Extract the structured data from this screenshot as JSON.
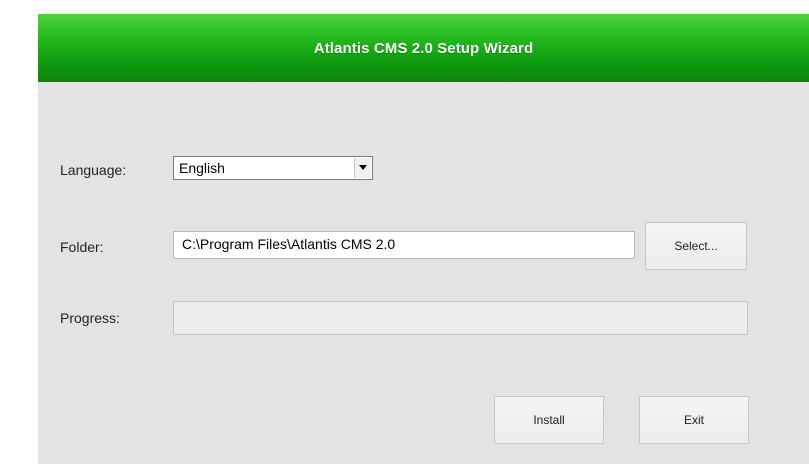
{
  "window": {
    "title": "Atlantis CMS 2.0 Setup Wizard"
  },
  "colors": {
    "titlebar_top": "#4fd33f",
    "titlebar_bottom": "#0b850b",
    "window_bg": "#e3e3e3"
  },
  "form": {
    "language_label": "Language:",
    "language_value": "English",
    "folder_label": "Folder:",
    "folder_value": "C:\\Program Files\\Atlantis CMS 2.0",
    "select_button": "Select...",
    "progress_label": "Progress:",
    "progress_fraction": 0
  },
  "footer": {
    "install_button": "Install",
    "exit_button": "Exit"
  }
}
